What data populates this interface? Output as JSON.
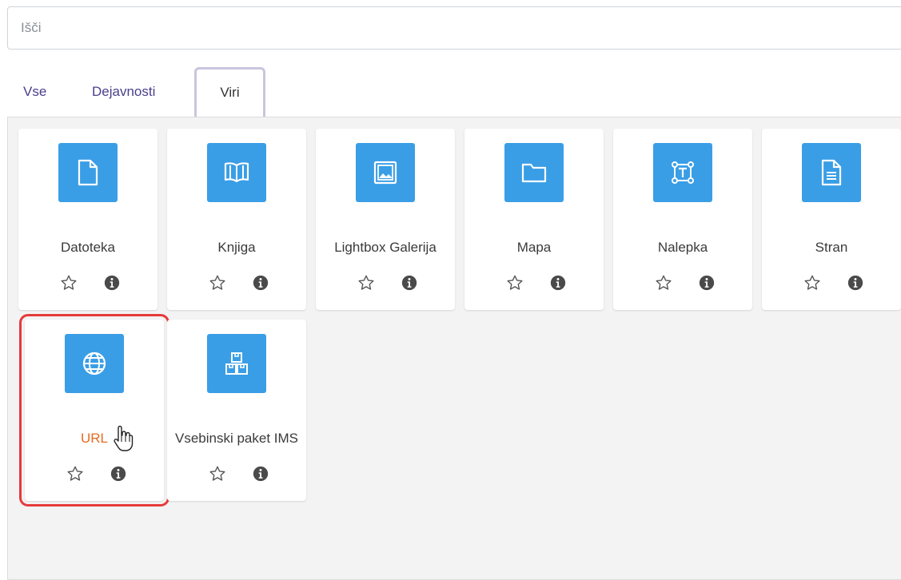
{
  "search": {
    "placeholder": "Išči",
    "value": ""
  },
  "tabs": [
    {
      "label": "Vse",
      "active": false
    },
    {
      "label": "Dejavnosti",
      "active": false
    },
    {
      "label": "Viri",
      "active": true
    }
  ],
  "modules": [
    {
      "name": "Datoteka",
      "icon": "file-icon"
    },
    {
      "name": "Knjiga",
      "icon": "book-icon"
    },
    {
      "name": "Lightbox Galerija",
      "icon": "image-gallery-icon"
    },
    {
      "name": "Mapa",
      "icon": "folder-icon"
    },
    {
      "name": "Nalepka",
      "icon": "label-text-icon"
    },
    {
      "name": "Stran",
      "icon": "page-icon"
    },
    {
      "name": "URL",
      "icon": "globe-icon",
      "selected": true
    },
    {
      "name": "Vsebinski paket IMS",
      "icon": "package-boxes-icon"
    }
  ],
  "colors": {
    "icon_bg": "#3a9ee6",
    "tab_text": "#4a3f8c",
    "link_orange": "#e56b1f",
    "highlight_red": "#e63b3b",
    "panel_bg": "#f3f3f3"
  }
}
